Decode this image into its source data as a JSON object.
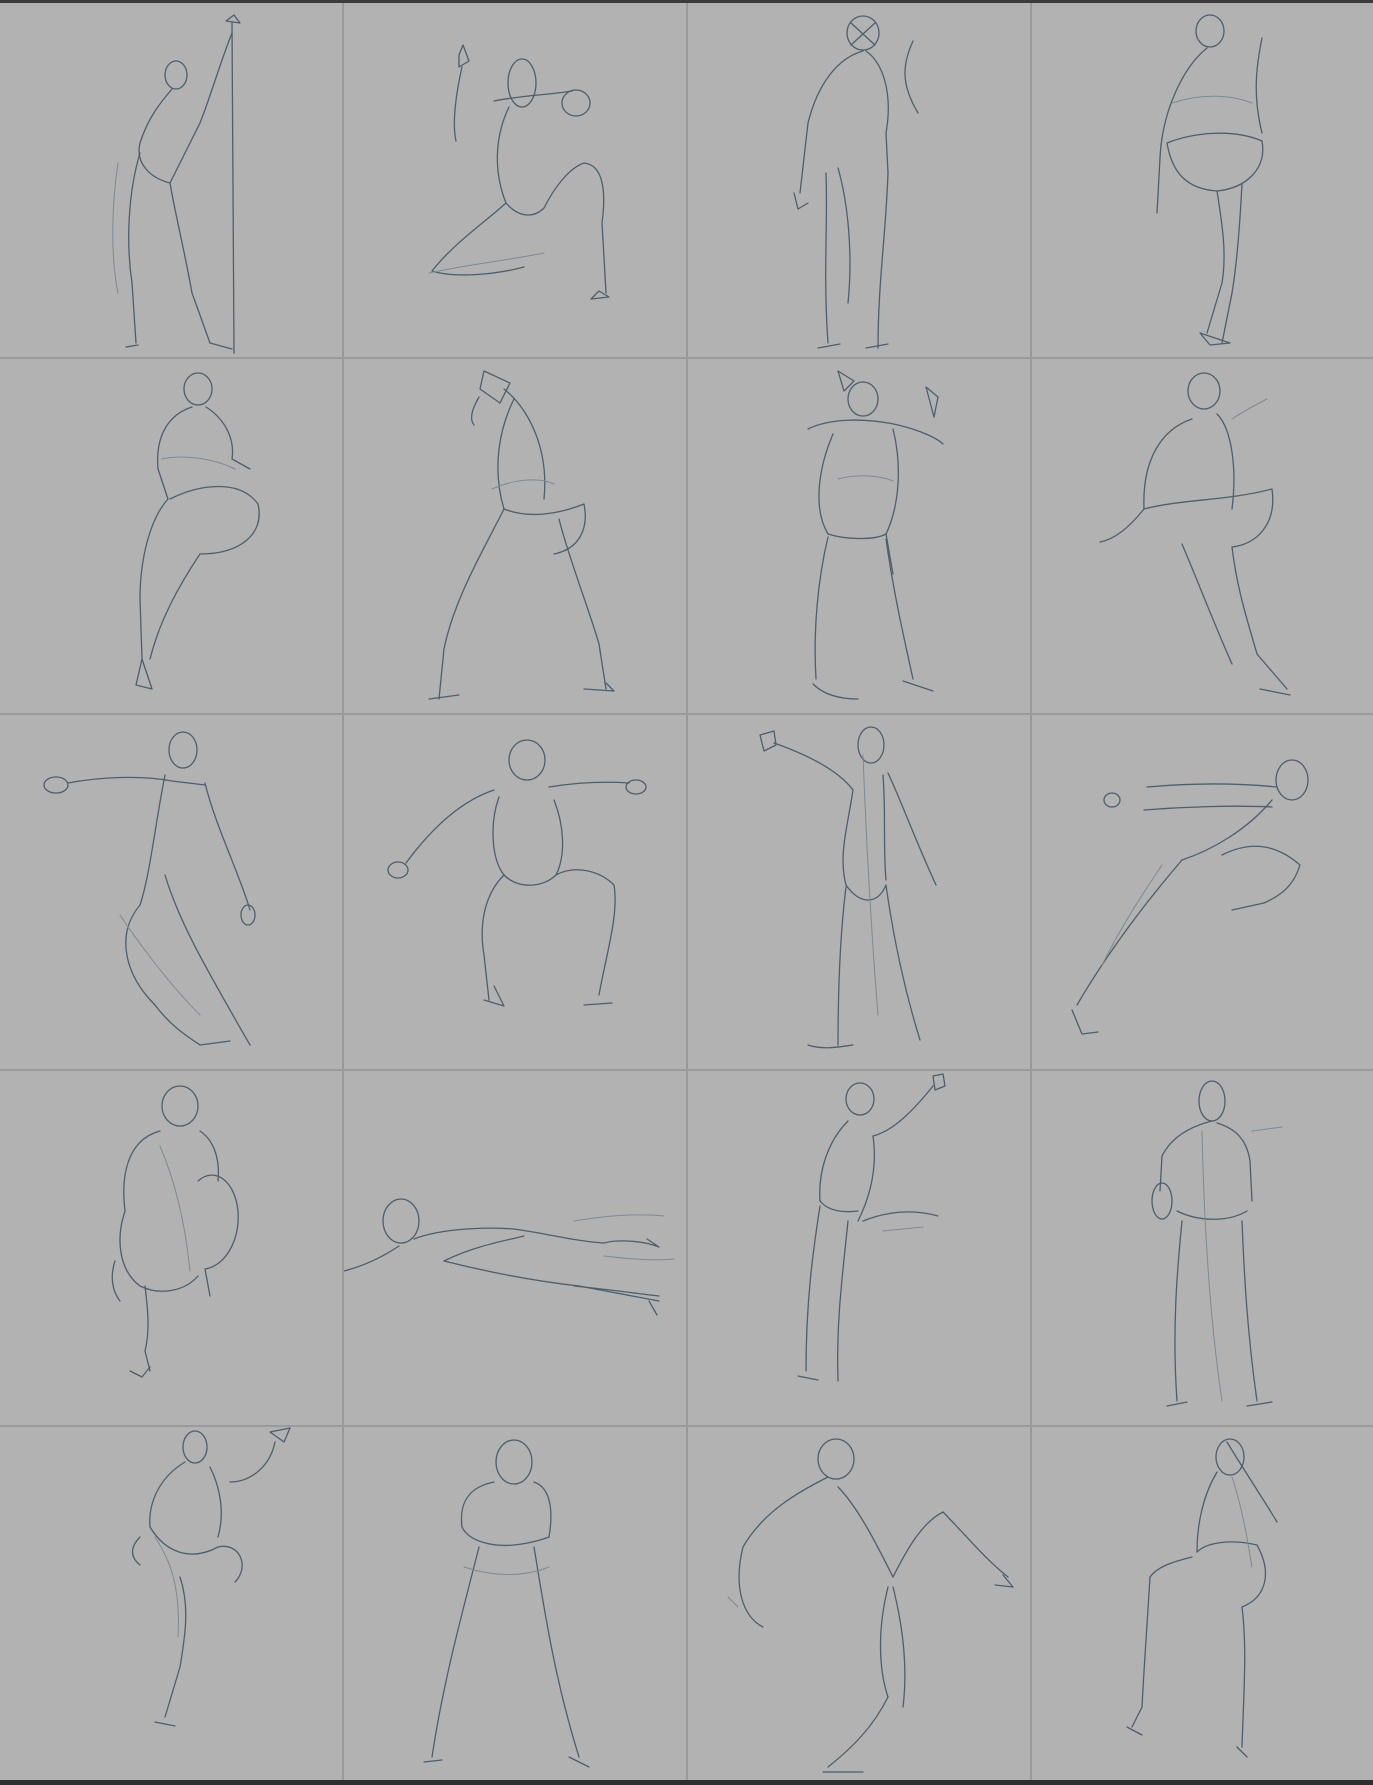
{
  "sheet": {
    "background_color": "#b2b2b2",
    "divider_color": "#9a9a9a",
    "line_color": "#4d5f6c",
    "rows": 5,
    "columns": 4
  },
  "sketches": [
    {
      "id": "r1c1",
      "pose": "standing-holding-staff"
    },
    {
      "id": "r1c2",
      "pose": "kneeling-arm-raised"
    },
    {
      "id": "r1c3",
      "pose": "standing-back-view"
    },
    {
      "id": "r1c4",
      "pose": "crouching-side"
    },
    {
      "id": "r2c1",
      "pose": "standing-knee-raised"
    },
    {
      "id": "r2c2",
      "pose": "wide-stance-arm-overhead"
    },
    {
      "id": "r2c3",
      "pose": "standing-arms-up"
    },
    {
      "id": "r2c4",
      "pose": "seated-leg-raised"
    },
    {
      "id": "r3c1",
      "pose": "standing-arm-extended"
    },
    {
      "id": "r3c2",
      "pose": "lunging-arms-wide"
    },
    {
      "id": "r3c3",
      "pose": "standing-arm-raised-back"
    },
    {
      "id": "r3c4",
      "pose": "leaning-lunge"
    },
    {
      "id": "r4c1",
      "pose": "crouching-back-view"
    },
    {
      "id": "r4c2",
      "pose": "lying-reclined"
    },
    {
      "id": "r4c3",
      "pose": "standing-arm-up-leg-out"
    },
    {
      "id": "r4c4",
      "pose": "standing-front"
    },
    {
      "id": "r5c1",
      "pose": "balancing-knee-up"
    },
    {
      "id": "r5c2",
      "pose": "standing-wide-legs"
    },
    {
      "id": "r5c3",
      "pose": "bending-kick"
    },
    {
      "id": "r5c4",
      "pose": "seated-side"
    }
  ]
}
